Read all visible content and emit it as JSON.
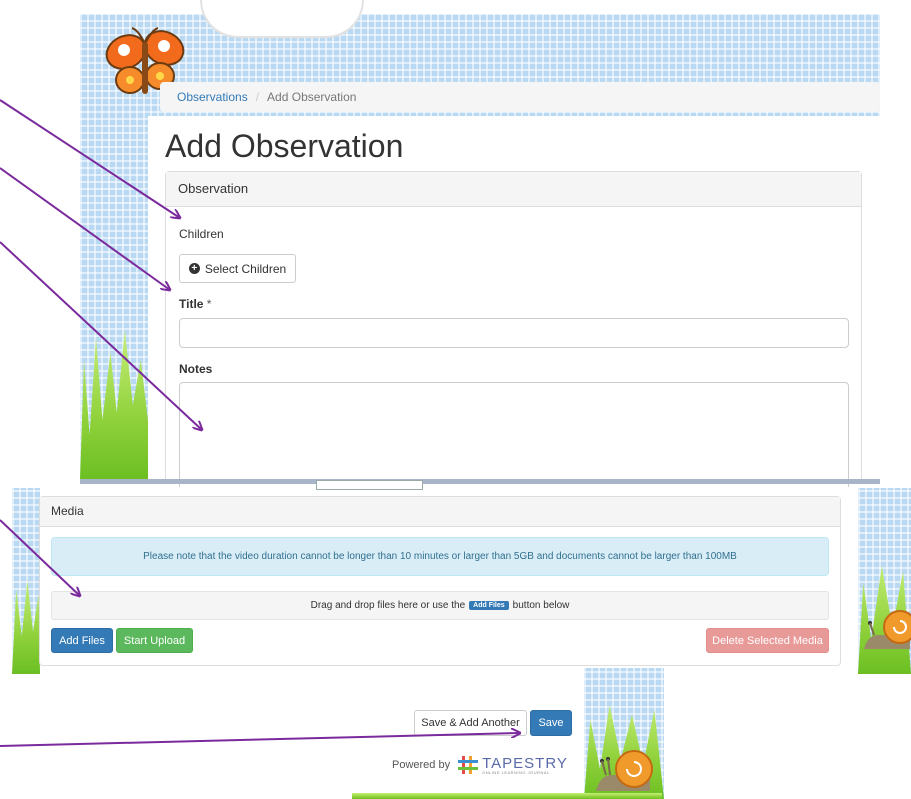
{
  "breadcrumb": {
    "link": "Observations",
    "separator": "/",
    "current": "Add Observation"
  },
  "page_title": "Add Observation",
  "observation_panel": {
    "heading": "Observation",
    "children_label": "Children",
    "select_children_button": "Select Children",
    "title_label": "Title",
    "required_marker": "*",
    "notes_label": "Notes"
  },
  "media_panel": {
    "heading": "Media",
    "note": "Please note that the video duration cannot be longer than 10 minutes or larger than 5GB and documents cannot be larger than 100MB",
    "drop_text_before": "Drag and drop files here or use the",
    "drop_inline_button": "Add Files",
    "drop_text_after": "button below",
    "add_files_button": "Add Files",
    "start_upload_button": "Start Upload",
    "delete_button": "Delete Selected Media"
  },
  "footer": {
    "save_add_another": "Save & Add Another",
    "save": "Save",
    "powered_by": "Powered by",
    "brand": "TAPESTRY",
    "brand_tagline": "ONLINE LEARNING JOURNAL"
  },
  "colors": {
    "primary": "#337ab7",
    "success": "#5cb85c",
    "danger_faded": "#e89a98",
    "annotation_arrow": "#7a2a9c",
    "info_bg": "#d9edf7"
  }
}
